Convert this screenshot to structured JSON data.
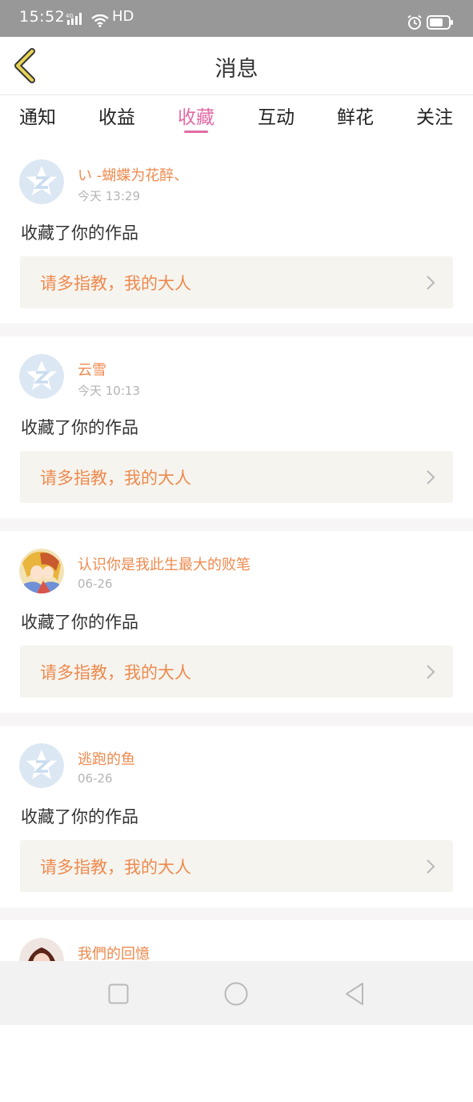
{
  "status_bar": {
    "time": "15:52",
    "network": "4G",
    "hd": "HD",
    "icons": [
      "signal-icon",
      "wifi-icon",
      "alarm-icon",
      "battery-icon"
    ]
  },
  "header": {
    "title": "消息",
    "back_icon": "chevron-left-icon",
    "back_color": "#e8d454"
  },
  "tabs": [
    {
      "label": "通知",
      "active": false
    },
    {
      "label": "收益",
      "active": false
    },
    {
      "label": "收藏",
      "active": true
    },
    {
      "label": "互动",
      "active": false
    },
    {
      "label": "鲜花",
      "active": false
    },
    {
      "label": "关注",
      "active": false
    }
  ],
  "colors": {
    "accent": "#e36aa4",
    "username": "#ee8a4e",
    "timestamp": "#b4b4b4",
    "message_bg": "#f5f4ef",
    "default_avatar": "#c9dcef"
  },
  "messages": [
    {
      "username": "い -蝴蝶为花醉、",
      "time": "今天 13:29",
      "action": "收藏了你的作品",
      "comment": "请多指教，我的大人",
      "avatar": "default-avatar-icon"
    },
    {
      "username": "云雪",
      "time": "今天 10:13",
      "action": "收藏了你的作品",
      "comment": "请多指教，我的大人",
      "avatar": "default-avatar-icon"
    },
    {
      "username": "认识你是我此生最大的败笔",
      "time": "06-26",
      "action": "收藏了你的作品",
      "comment": "请多指教，我的大人",
      "avatar": "anime-avatar"
    },
    {
      "username": "逃跑的鱼",
      "time": "06-26",
      "action": "收藏了你的作品",
      "comment": "请多指教，我的大人",
      "avatar": "default-avatar-icon"
    },
    {
      "username": "我們的回憶",
      "time": "",
      "action": "",
      "comment": "",
      "avatar": "photo-avatar"
    }
  ],
  "nav_bar": {
    "icons": [
      "square-recent-apps-icon",
      "circle-home-icon",
      "triangle-back-icon"
    ]
  }
}
